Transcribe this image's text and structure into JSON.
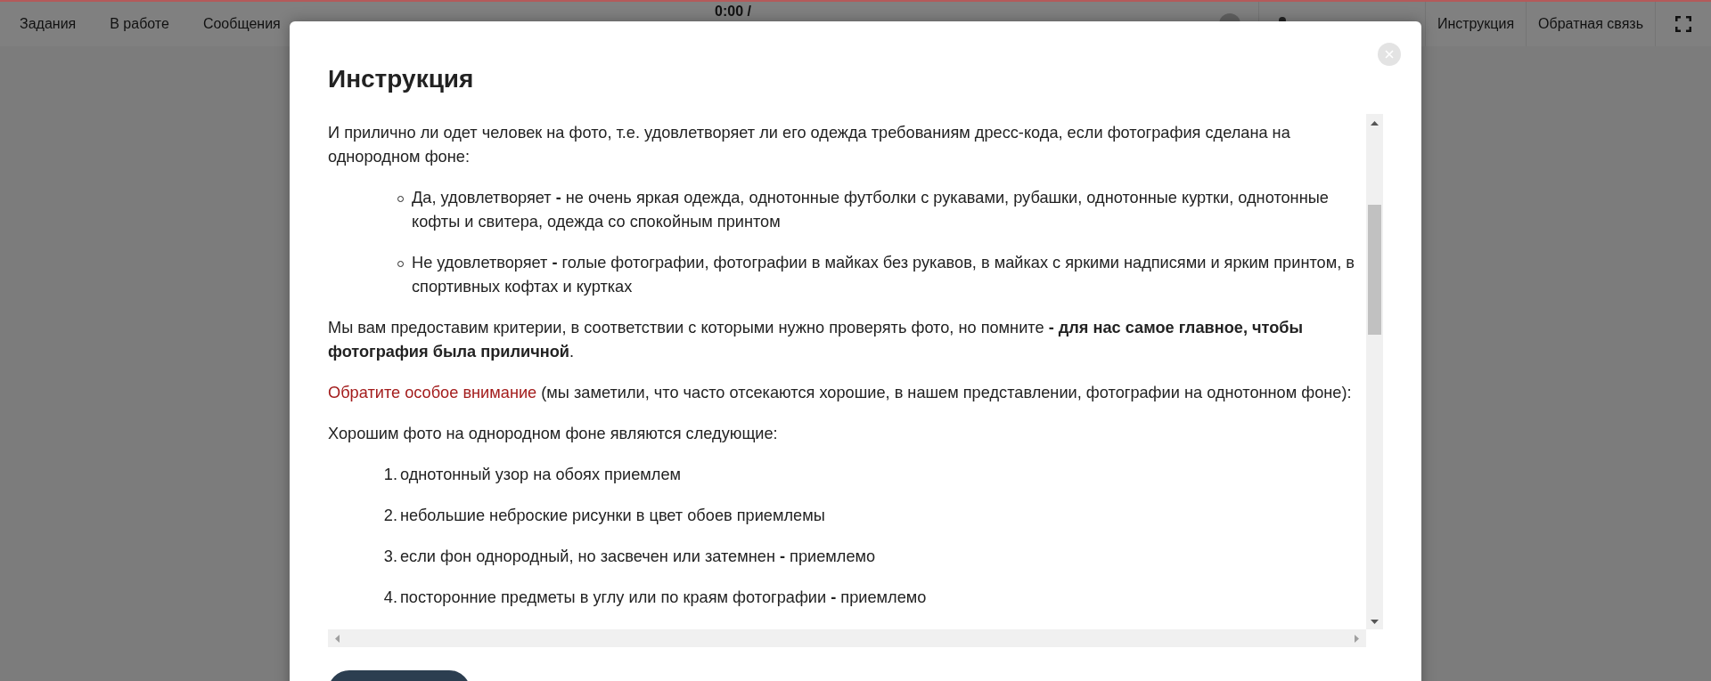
{
  "topbar": {
    "nav": [
      "Задания",
      "В работе",
      "Сообщения"
    ],
    "timer": "0:00 /",
    "links": [
      "Инструкция",
      "Обратная связь"
    ]
  },
  "modal": {
    "title": "Инструкция",
    "blocks": [
      {
        "kind": "paragraph",
        "text": "И прилично ли одет человек на фото, т.е. удовлетворяет ли его одежда требованиям дресс-кода, если фотография сделана на однородном фоне:"
      },
      {
        "kind": "bullets",
        "items": [
          "Да, удовлетворяет **-** не очень яркая одежда, однотонные футболки с рукавами, рубашки, однотонные куртки, однотонные кофты и свитера, одежда со спокойным принтом",
          "Не удовлетворяет **-** голые фотографии, фотографии в майках без рукавов, в майках с яркими надписями и ярким принтом, в спортивных кофтах и куртках"
        ]
      },
      {
        "kind": "paragraph",
        "text": "Мы вам предоставим критерии, в соответствии с которыми нужно проверять фото, но помните **- для нас самое главное, чтобы фотография была приличной**."
      },
      {
        "kind": "accent",
        "accent": "Обратите особое внимание",
        "text": " (мы заметили, что часто отсекаются хорошие, в нашем представлении, фотографии на однотонном фоне):"
      },
      {
        "kind": "paragraph",
        "text": "Хорошим фото на однородном фоне являются следующие:"
      },
      {
        "kind": "numbered",
        "items": [
          {
            "marker": "1.",
            "text": "однотонный узор на обоях приемлем"
          },
          {
            "marker": "2.",
            "text": "небольшие неброские рисунки в цвет обоев приемлемы"
          },
          {
            "marker": "3.",
            "text": "если фон однородный, но засвечен или затемнен **-** приемлемо"
          },
          {
            "marker": "4.",
            "text": "посторонние предметы в углу или по краям фотографии **-** приемлемо"
          }
        ]
      }
    ]
  }
}
